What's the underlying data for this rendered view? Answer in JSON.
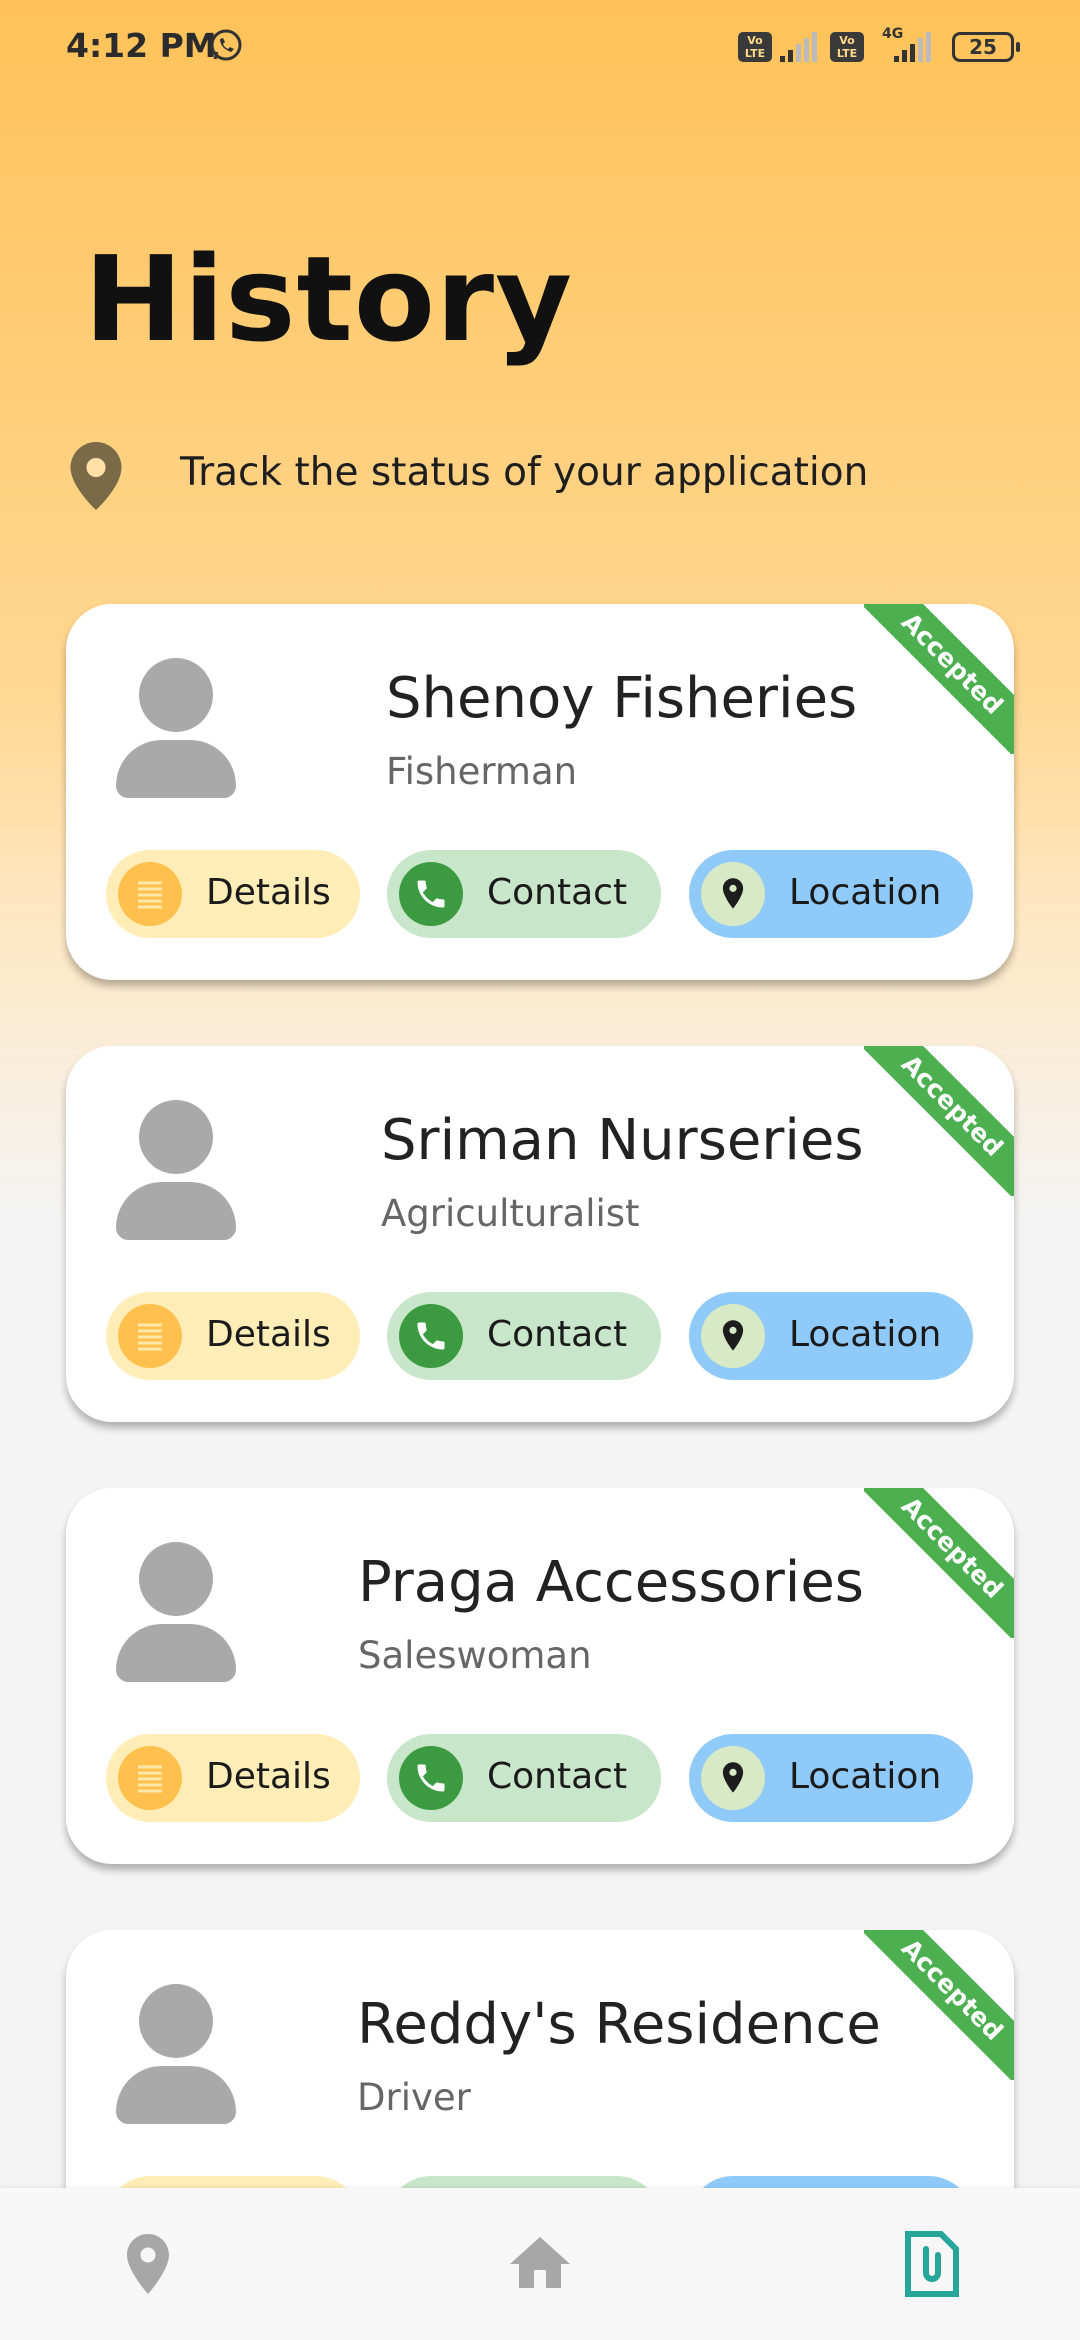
{
  "status_bar": {
    "time": "4:12 PM",
    "volte_label": "Vo LTE",
    "network_4g": "4G",
    "battery": "25"
  },
  "page": {
    "title": "History",
    "subtitle": "Track the status of your application"
  },
  "cards": [
    {
      "name": "Shenoy Fisheries",
      "role": "Fisherman",
      "status": "Accepted"
    },
    {
      "name": "Sriman Nurseries",
      "role": "Agriculturalist",
      "status": "Accepted"
    },
    {
      "name": "Praga Accessories",
      "role": "Saleswoman",
      "status": "Accepted"
    },
    {
      "name": "Reddy's Residence",
      "role": "Driver",
      "status": "Accepted"
    }
  ],
  "card_actions": {
    "details": "Details",
    "contact": "Contact",
    "location": "Location"
  },
  "bottom_nav": {
    "items": [
      "location-pin-icon",
      "home-icon",
      "documents-icon"
    ],
    "active": "documents-icon"
  },
  "colors": {
    "accepted": "#4CAF50",
    "details_bg": "#FFEDB8",
    "contact_bg": "#C8E6C9",
    "location_bg": "#90CAF9",
    "nav_active": "#26A69A"
  }
}
